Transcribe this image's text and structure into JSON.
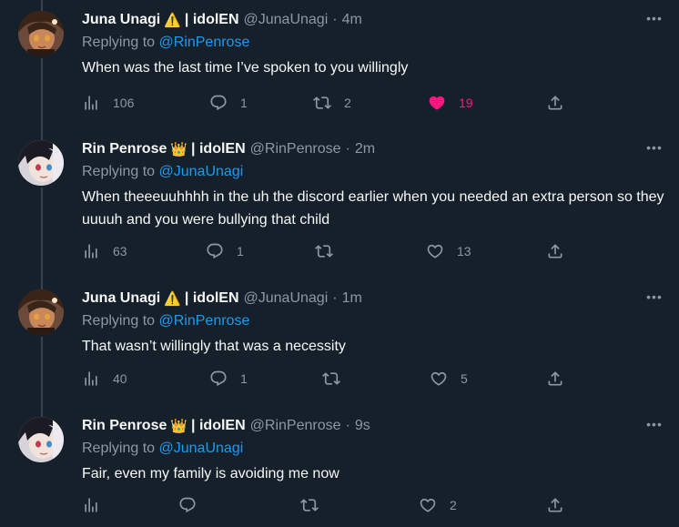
{
  "colors": {
    "background": "#15202b",
    "muted": "#8b98a5",
    "mention": "#1d9bf0",
    "like": "#f91880"
  },
  "tweets": [
    {
      "name": "Juna Unagi",
      "badge": "⚠️",
      "suffix": "| idolEN",
      "handle": "@JunaUnagi",
      "time": "4m",
      "reply_prefix": "Replying to",
      "reply_to": "@RinPenrose",
      "text": "When was the last time I’ve spoken to you willingly",
      "views": "106",
      "replies": "1",
      "retweets": "2",
      "likes": "19",
      "liked": true
    },
    {
      "name": "Rin Penrose",
      "badge": "👑",
      "suffix": "| idolEN",
      "handle": "@RinPenrose",
      "time": "2m",
      "reply_prefix": "Replying to",
      "reply_to": "@JunaUnagi",
      "text": "When theeeuuhhhh in the uh the discord earlier when you needed an extra person so they uuuuh and you were bullying that child",
      "views": "63",
      "replies": "1",
      "retweets": "",
      "likes": "13",
      "liked": false
    },
    {
      "name": "Juna Unagi",
      "badge": "⚠️",
      "suffix": "| idolEN",
      "handle": "@JunaUnagi",
      "time": "1m",
      "reply_prefix": "Replying to",
      "reply_to": "@RinPenrose",
      "text": "That wasn’t willingly that was a necessity",
      "views": "40",
      "replies": "1",
      "retweets": "",
      "likes": "5",
      "liked": false
    },
    {
      "name": "Rin Penrose",
      "badge": "👑",
      "suffix": "| idolEN",
      "handle": "@RinPenrose",
      "time": "9s",
      "reply_prefix": "Replying to",
      "reply_to": "@JunaUnagi",
      "text": "Fair, even my family is avoiding me now",
      "views": "",
      "replies": "",
      "retweets": "",
      "likes": "2",
      "liked": false
    }
  ]
}
